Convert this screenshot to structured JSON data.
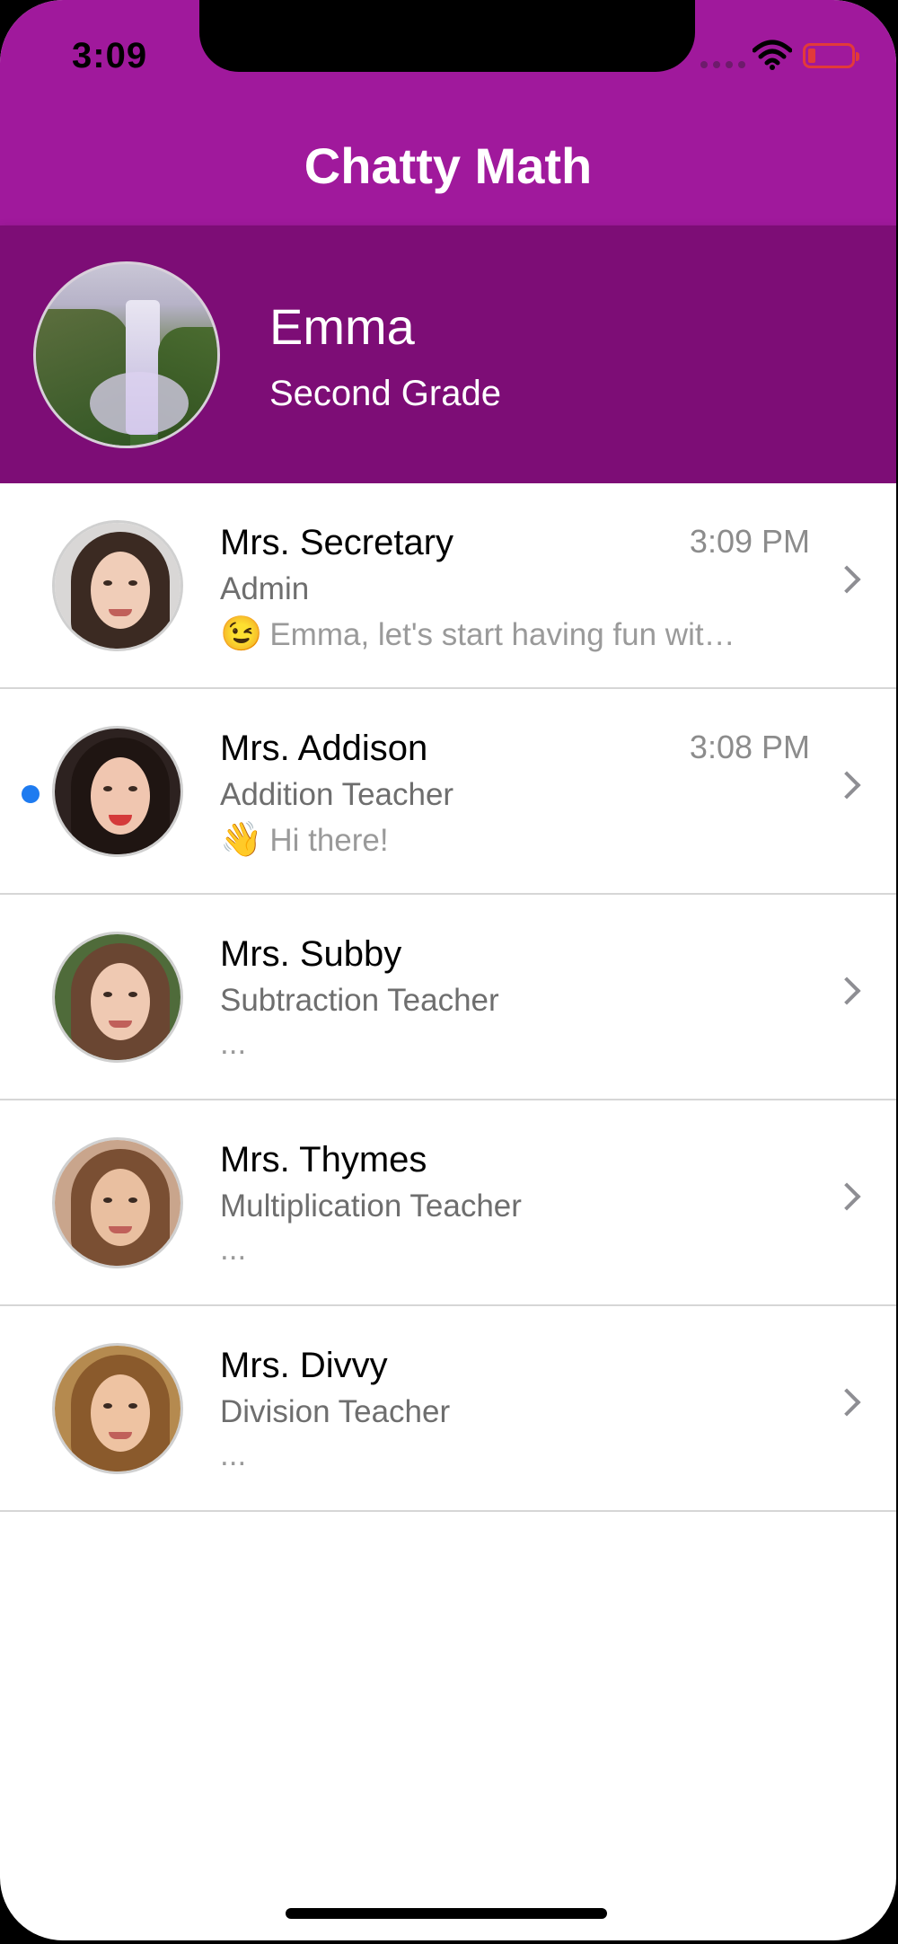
{
  "status_bar": {
    "time": "3:09"
  },
  "nav": {
    "title": "Chatty Math"
  },
  "profile": {
    "name": "Emma",
    "grade": "Second Grade",
    "avatar_icon": "waterfall-photo"
  },
  "colors": {
    "nav_bg": "#a0199c",
    "profile_bg": "#7d0d76",
    "unread_dot": "#1e7bf0"
  },
  "chats": [
    {
      "name": "Mrs. Secretary",
      "role": "Admin",
      "time": "3:09 PM",
      "emoji": "😉",
      "message": "Emma, let's start having fun wit…",
      "unread": false
    },
    {
      "name": "Mrs. Addison",
      "role": "Addition Teacher",
      "time": "3:08 PM",
      "emoji": "👋",
      "message": "Hi there!",
      "unread": true
    },
    {
      "name": "Mrs. Subby",
      "role": "Subtraction Teacher",
      "time": "",
      "emoji": "",
      "message": "...",
      "unread": false
    },
    {
      "name": "Mrs. Thymes",
      "role": "Multiplication Teacher",
      "time": "",
      "emoji": "",
      "message": "...",
      "unread": false
    },
    {
      "name": "Mrs. Divvy",
      "role": "Division Teacher",
      "time": "",
      "emoji": "",
      "message": "...",
      "unread": false
    }
  ]
}
